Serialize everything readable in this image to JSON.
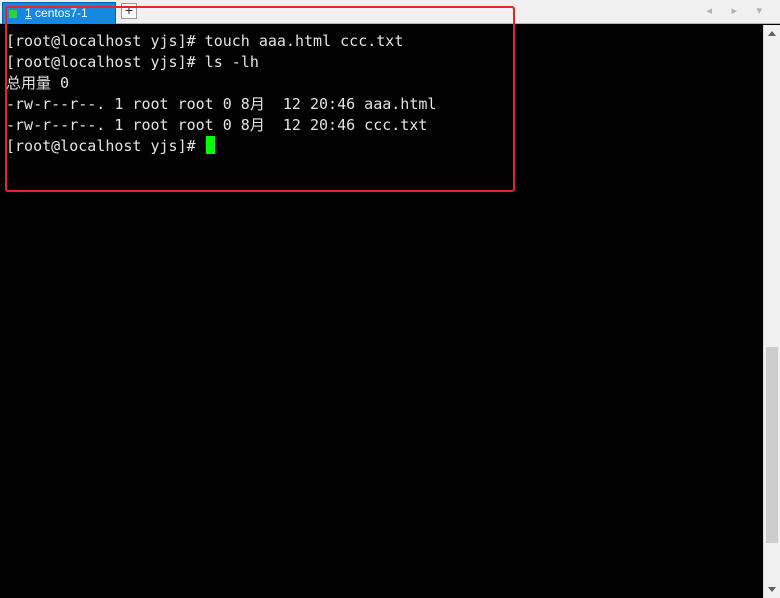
{
  "tab": {
    "number": "1",
    "title": "centos7-1",
    "add_label": "+"
  },
  "nav": {
    "arrows": "◂ ▸ ▾"
  },
  "terminal": {
    "lines": [
      "[root@localhost yjs]# touch aaa.html ccc.txt",
      "[root@localhost yjs]# ls -lh",
      "总用量 0",
      "-rw-r--r--. 1 root root 0 8月  12 20:46 aaa.html",
      "-rw-r--r--. 1 root root 0 8月  12 20:46 ccc.txt"
    ],
    "prompt": "[root@localhost yjs]# "
  },
  "colors": {
    "background": "#000000",
    "text": "#e4e4e4",
    "cursor": "#00ff00",
    "tab_active": "#1688e0",
    "highlight": "#e8242a"
  },
  "icons": {
    "tab_status": "green-square-icon",
    "add_tab": "plus-icon",
    "scroll_up": "arrow-up-icon",
    "scroll_down": "arrow-down-icon"
  }
}
